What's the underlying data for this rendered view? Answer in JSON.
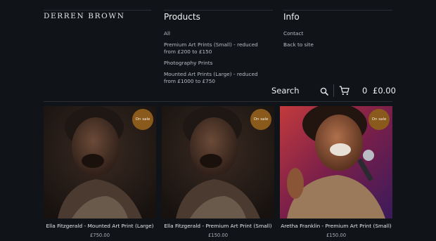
{
  "brand": "DERREN BROWN",
  "products_nav": {
    "title": "Products",
    "items": [
      "All",
      "Premium Art Prints (Small) - reduced from £200 to £150",
      "Photography Prints",
      "Mounted Art Prints (Large) - reduced from £1000 to £750"
    ]
  },
  "info_nav": {
    "title": "Info",
    "items": [
      "Contact",
      "Back to site"
    ]
  },
  "toolbar": {
    "search_label": "Search",
    "cart_count": "0",
    "cart_total": "£0.00"
  },
  "products": [
    {
      "title": "Ella Fitzgerald - Mounted Art Print (Large)",
      "price": "£750.00",
      "badge": "On sale"
    },
    {
      "title": "Ella Fitzgerald - Premium Art Print (Small)",
      "price": "£150.00",
      "badge": "On sale"
    },
    {
      "title": "Aretha Franklin - Premium Art Print (Small)",
      "price": "£150.00",
      "badge": "On sale"
    }
  ],
  "colors": {
    "background": "#101318",
    "badge": "#8a5a1c",
    "text": "#cfd3d8"
  }
}
